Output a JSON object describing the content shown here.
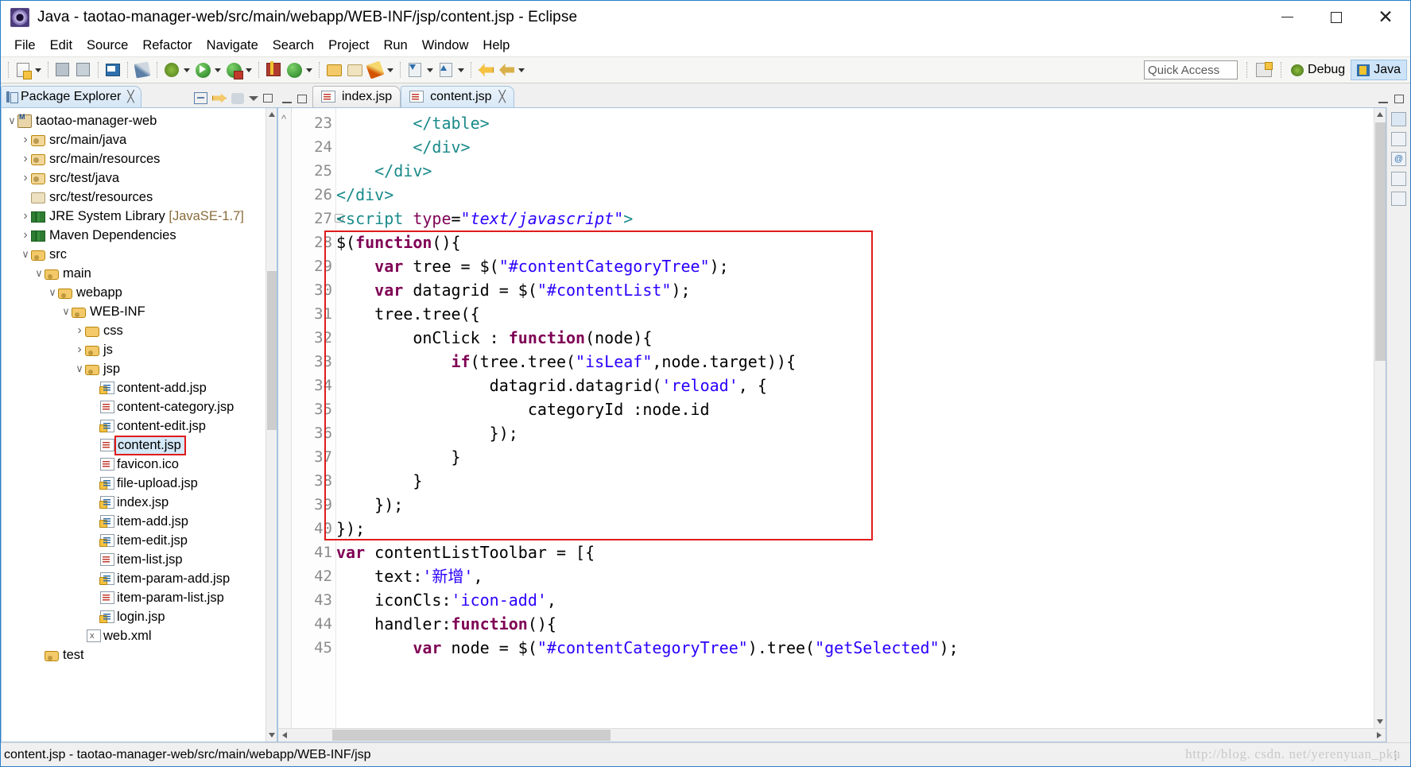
{
  "window": {
    "title": "Java - taotao-manager-web/src/main/webapp/WEB-INF/jsp/content.jsp - Eclipse",
    "app_icon": "eclipse-icon",
    "minimize_label": "−",
    "maximize_label": "",
    "close_label": "✕"
  },
  "menubar": {
    "items": [
      "File",
      "Edit",
      "Source",
      "Refactor",
      "Navigate",
      "Search",
      "Project",
      "Run",
      "Window",
      "Help"
    ]
  },
  "toolbar": {
    "quick_access_placeholder": "Quick Access",
    "perspective_open_icon": "open-perspective-icon",
    "perspectives": [
      {
        "label": "Debug",
        "icon": "debug-perspective-icon",
        "active": false
      },
      {
        "label": "Java",
        "icon": "java-perspective-icon",
        "active": true
      }
    ]
  },
  "sidebar": {
    "view_title": "Package Explorer",
    "view_icon": "package-explorer-icon",
    "close_icon": "close-icon",
    "actions": [
      "collapse-all-icon",
      "link-with-editor-icon",
      "view-menu-icon",
      "minimize-icon",
      "maximize-icon"
    ],
    "tree": [
      {
        "label": "taotao-manager-web",
        "indent": 0,
        "twisty": "down",
        "icon": "maven-project-icon",
        "selected": false
      },
      {
        "label": "src/main/java",
        "indent": 1,
        "twisty": "right",
        "icon": "source-package-icon",
        "selected": false
      },
      {
        "label": "src/main/resources",
        "indent": 1,
        "twisty": "right",
        "icon": "source-package-icon",
        "selected": false
      },
      {
        "label": "src/test/java",
        "indent": 1,
        "twisty": "right",
        "icon": "source-package-icon",
        "selected": false
      },
      {
        "label": "src/test/resources",
        "indent": 1,
        "twisty": "none",
        "icon": "package-icon",
        "selected": false
      },
      {
        "label": "JRE System Library ",
        "dim": "[JavaSE-1.7]",
        "indent": 1,
        "twisty": "right",
        "icon": "library-icon",
        "selected": false
      },
      {
        "label": "Maven Dependencies",
        "indent": 1,
        "twisty": "right",
        "icon": "library-icon",
        "selected": false
      },
      {
        "label": "src",
        "indent": 1,
        "twisty": "down",
        "icon": "folder-icon",
        "selected": false
      },
      {
        "label": "main",
        "indent": 2,
        "twisty": "down",
        "icon": "folder-icon",
        "selected": false
      },
      {
        "label": "webapp",
        "indent": 3,
        "twisty": "down",
        "icon": "folder-icon",
        "selected": false
      },
      {
        "label": "WEB-INF",
        "indent": 4,
        "twisty": "down",
        "icon": "folder-icon",
        "selected": false
      },
      {
        "label": "css",
        "indent": 5,
        "twisty": "right",
        "icon": "folder-plain-icon",
        "selected": false
      },
      {
        "label": "js",
        "indent": 5,
        "twisty": "right",
        "icon": "folder-icon",
        "selected": false
      },
      {
        "label": "jsp",
        "indent": 5,
        "twisty": "down",
        "icon": "folder-icon",
        "selected": false
      },
      {
        "label": "content-add.jsp",
        "indent": 6,
        "twisty": "none",
        "icon": "jsp-file-warning-icon",
        "selected": false
      },
      {
        "label": "content-category.jsp",
        "indent": 6,
        "twisty": "none",
        "icon": "jsp-file-icon",
        "selected": false
      },
      {
        "label": "content-edit.jsp",
        "indent": 6,
        "twisty": "none",
        "icon": "jsp-file-warning-icon",
        "selected": false
      },
      {
        "label": "content.jsp",
        "indent": 6,
        "twisty": "none",
        "icon": "jsp-file-icon",
        "selected": true
      },
      {
        "label": "favicon.ico",
        "indent": 6,
        "twisty": "none",
        "icon": "file-icon",
        "selected": false
      },
      {
        "label": "file-upload.jsp",
        "indent": 6,
        "twisty": "none",
        "icon": "jsp-file-warning-icon",
        "selected": false
      },
      {
        "label": "index.jsp",
        "indent": 6,
        "twisty": "none",
        "icon": "jsp-file-warning-icon",
        "selected": false
      },
      {
        "label": "item-add.jsp",
        "indent": 6,
        "twisty": "none",
        "icon": "jsp-file-warning-icon",
        "selected": false
      },
      {
        "label": "item-edit.jsp",
        "indent": 6,
        "twisty": "none",
        "icon": "jsp-file-warning-icon",
        "selected": false
      },
      {
        "label": "item-list.jsp",
        "indent": 6,
        "twisty": "none",
        "icon": "jsp-file-icon",
        "selected": false
      },
      {
        "label": "item-param-add.jsp",
        "indent": 6,
        "twisty": "none",
        "icon": "jsp-file-warning-icon",
        "selected": false
      },
      {
        "label": "item-param-list.jsp",
        "indent": 6,
        "twisty": "none",
        "icon": "jsp-file-icon",
        "selected": false
      },
      {
        "label": "login.jsp",
        "indent": 6,
        "twisty": "none",
        "icon": "jsp-file-warning-icon",
        "selected": false
      },
      {
        "label": "web.xml",
        "indent": 5,
        "twisty": "none",
        "icon": "xml-file-icon",
        "selected": false
      },
      {
        "label": "test",
        "indent": 2,
        "twisty": "none",
        "icon": "folder-icon",
        "selected": false
      }
    ]
  },
  "editor": {
    "tabs": [
      {
        "label": "index.jsp",
        "active": false,
        "closable": false,
        "icon": "jsp-file-icon"
      },
      {
        "label": "content.jsp",
        "active": true,
        "closable": true,
        "icon": "jsp-file-icon",
        "close_icon": "close-icon"
      }
    ],
    "first_line_number": 23,
    "lines": [
      {
        "n": 23,
        "fold": false,
        "tokens": [
          {
            "t": "        ",
            "c": "plain"
          },
          {
            "t": "</table>",
            "c": "tag"
          }
        ]
      },
      {
        "n": 24,
        "fold": false,
        "tokens": [
          {
            "t": "        ",
            "c": "plain"
          },
          {
            "t": "</div>",
            "c": "tag"
          }
        ]
      },
      {
        "n": 25,
        "fold": false,
        "tokens": [
          {
            "t": "    ",
            "c": "plain"
          },
          {
            "t": "</div>",
            "c": "tag"
          }
        ]
      },
      {
        "n": 26,
        "fold": false,
        "tokens": [
          {
            "t": "</div>",
            "c": "tag"
          }
        ]
      },
      {
        "n": 27,
        "fold": true,
        "tokens": [
          {
            "t": "<script ",
            "c": "tag"
          },
          {
            "t": "type",
            "c": "attr"
          },
          {
            "t": "=",
            "c": "plain"
          },
          {
            "t": "\"text/javascript\"",
            "c": "stri"
          },
          {
            "t": ">",
            "c": "tag"
          }
        ]
      },
      {
        "n": 28,
        "fold": false,
        "tokens": [
          {
            "t": "$(",
            "c": "plain"
          },
          {
            "t": "function",
            "c": "kw"
          },
          {
            "t": "(){",
            "c": "plain"
          }
        ]
      },
      {
        "n": 29,
        "fold": false,
        "tokens": [
          {
            "t": "    ",
            "c": "plain"
          },
          {
            "t": "var",
            "c": "kw"
          },
          {
            "t": " tree = $(",
            "c": "plain"
          },
          {
            "t": "\"#contentCategoryTree\"",
            "c": "str"
          },
          {
            "t": ");",
            "c": "plain"
          }
        ]
      },
      {
        "n": 30,
        "fold": false,
        "tokens": [
          {
            "t": "    ",
            "c": "plain"
          },
          {
            "t": "var",
            "c": "kw"
          },
          {
            "t": " datagrid = $(",
            "c": "plain"
          },
          {
            "t": "\"#contentList\"",
            "c": "str"
          },
          {
            "t": ");",
            "c": "plain"
          }
        ]
      },
      {
        "n": 31,
        "fold": false,
        "tokens": [
          {
            "t": "    tree.tree({",
            "c": "plain"
          }
        ]
      },
      {
        "n": 32,
        "fold": false,
        "tokens": [
          {
            "t": "        onClick : ",
            "c": "plain"
          },
          {
            "t": "function",
            "c": "kw"
          },
          {
            "t": "(node){",
            "c": "plain"
          }
        ]
      },
      {
        "n": 33,
        "fold": false,
        "tokens": [
          {
            "t": "            ",
            "c": "plain"
          },
          {
            "t": "if",
            "c": "kw"
          },
          {
            "t": "(tree.tree(",
            "c": "plain"
          },
          {
            "t": "\"isLeaf\"",
            "c": "str"
          },
          {
            "t": ",node.target)){",
            "c": "plain"
          }
        ]
      },
      {
        "n": 34,
        "fold": false,
        "tokens": [
          {
            "t": "                datagrid.datagrid(",
            "c": "plain"
          },
          {
            "t": "'reload'",
            "c": "str"
          },
          {
            "t": ", {",
            "c": "plain"
          }
        ]
      },
      {
        "n": 35,
        "fold": false,
        "tokens": [
          {
            "t": "                    categoryId :node.id",
            "c": "plain"
          }
        ]
      },
      {
        "n": 36,
        "fold": false,
        "tokens": [
          {
            "t": "                });",
            "c": "plain"
          }
        ]
      },
      {
        "n": 37,
        "fold": false,
        "tokens": [
          {
            "t": "            }",
            "c": "plain"
          }
        ]
      },
      {
        "n": 38,
        "fold": false,
        "tokens": [
          {
            "t": "        }",
            "c": "plain"
          }
        ]
      },
      {
        "n": 39,
        "fold": false,
        "tokens": [
          {
            "t": "    });",
            "c": "plain"
          }
        ]
      },
      {
        "n": 40,
        "fold": false,
        "tokens": [
          {
            "t": "});",
            "c": "plain"
          }
        ]
      },
      {
        "n": 41,
        "fold": false,
        "tokens": [
          {
            "t": "var",
            "c": "kw"
          },
          {
            "t": " contentListToolbar = [{",
            "c": "plain"
          }
        ]
      },
      {
        "n": 42,
        "fold": false,
        "tokens": [
          {
            "t": "    text:",
            "c": "plain"
          },
          {
            "t": "'新增'",
            "c": "str"
          },
          {
            "t": ",",
            "c": "plain"
          }
        ]
      },
      {
        "n": 43,
        "fold": false,
        "tokens": [
          {
            "t": "    iconCls:",
            "c": "plain"
          },
          {
            "t": "'icon-add'",
            "c": "str"
          },
          {
            "t": ",",
            "c": "plain"
          }
        ]
      },
      {
        "n": 44,
        "fold": false,
        "tokens": [
          {
            "t": "    handler:",
            "c": "plain"
          },
          {
            "t": "function",
            "c": "kw"
          },
          {
            "t": "(){",
            "c": "plain"
          }
        ]
      },
      {
        "n": 45,
        "fold": false,
        "tokens": [
          {
            "t": "        ",
            "c": "plain"
          },
          {
            "t": "var",
            "c": "kw"
          },
          {
            "t": " node = $(",
            "c": "plain"
          },
          {
            "t": "\"#contentCategoryTree\"",
            "c": "str"
          },
          {
            "t": ").tree(",
            "c": "plain"
          },
          {
            "t": "\"getSelected\"",
            "c": "str"
          },
          {
            "t": ");",
            "c": "plain"
          }
        ]
      }
    ],
    "highlight_box": {
      "from_line": 28,
      "to_line": 40,
      "color": "#e01b1b"
    }
  },
  "right_rail": {
    "icons": [
      "outline-icon",
      "task-icon",
      "at-icon",
      "markers-icon",
      "console-icon"
    ]
  },
  "statusbar": {
    "text": "content.jsp - taotao-manager-web/src/main/webapp/WEB-INF/jsp",
    "watermark": "http://blog. csdn. net/yerenyuan_pku"
  },
  "colors": {
    "accent": "#2a7fc9",
    "highlight_red": "#e01b1b",
    "selection_blue": "#d5e8f7",
    "string_blue": "#2a00ff",
    "keyword_purple": "#7f0055",
    "tag_teal": "#1a8a8a"
  }
}
